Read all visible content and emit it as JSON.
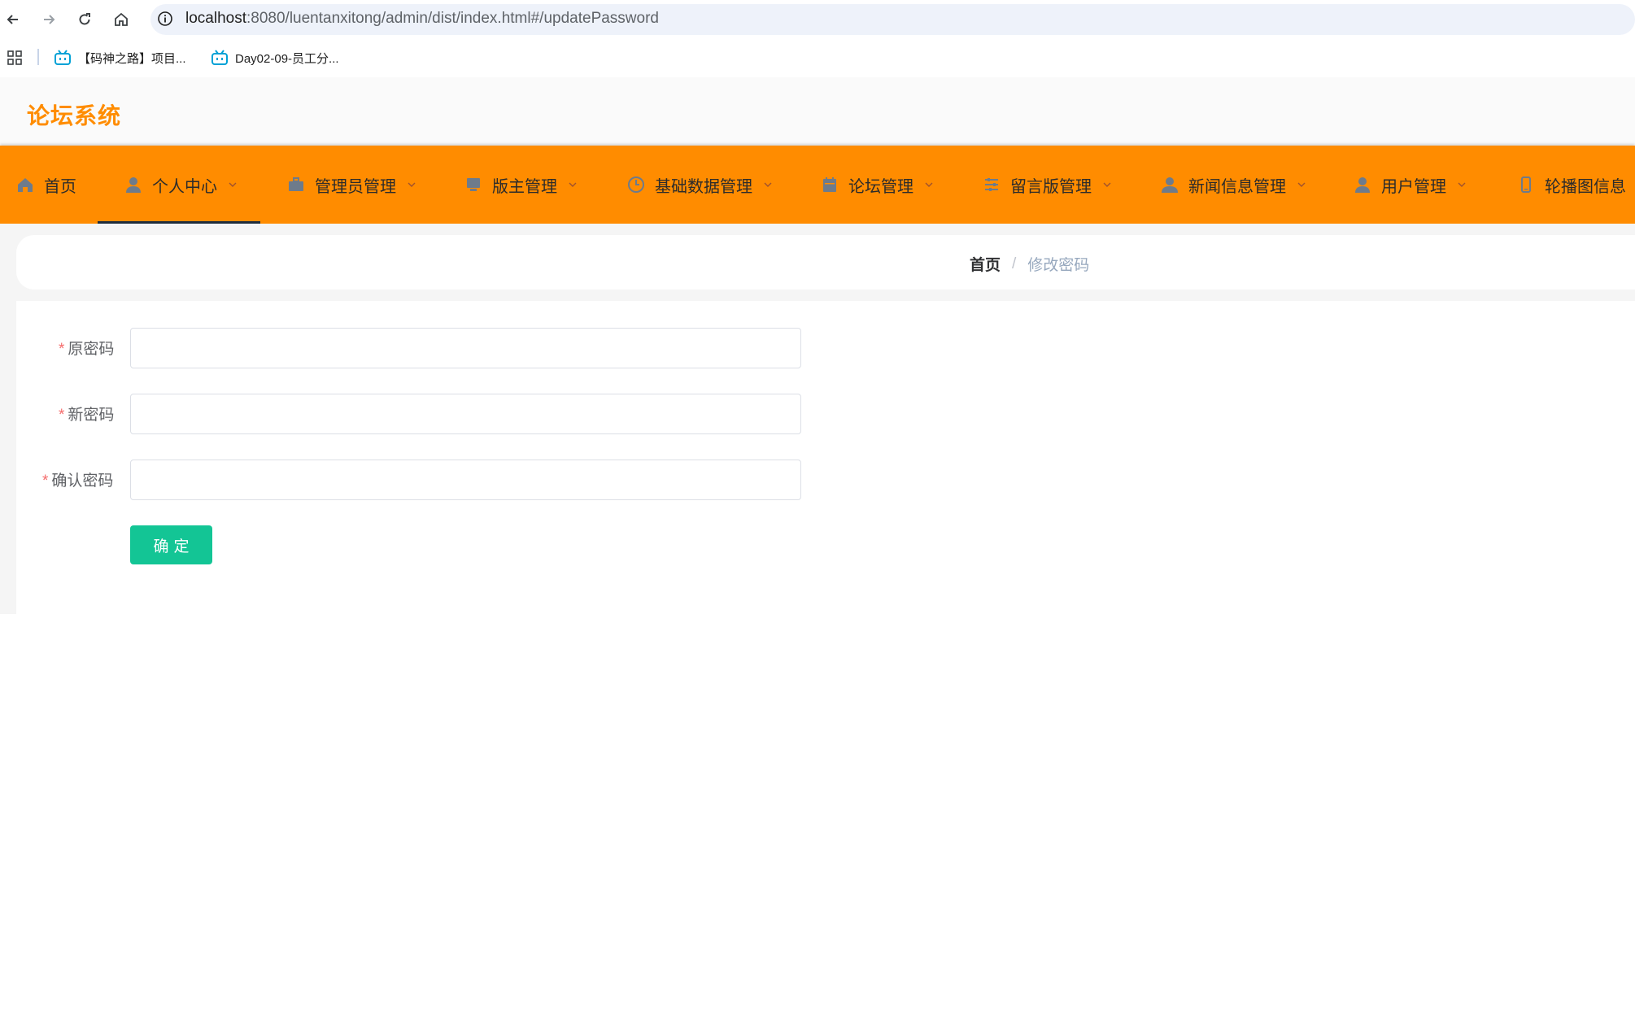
{
  "browser": {
    "url_host": "localhost",
    "url_path": ":8080/luentanxitong/admin/dist/index.html#/updatePassword",
    "bookmarks": [
      {
        "label": "【码神之路】项目..."
      },
      {
        "label": "Day02-09-员工分..."
      }
    ]
  },
  "app": {
    "title": "论坛系统"
  },
  "menu": {
    "items": [
      {
        "label": "首页",
        "icon": "home-icon"
      },
      {
        "label": "个人中心",
        "icon": "user-icon",
        "active": true
      },
      {
        "label": "管理员管理",
        "icon": "briefcase-icon"
      },
      {
        "label": "版主管理",
        "icon": "monitor-icon"
      },
      {
        "label": "基础数据管理",
        "icon": "clock-icon"
      },
      {
        "label": "论坛管理",
        "icon": "calendar-icon"
      },
      {
        "label": "留言版管理",
        "icon": "sliders-icon"
      },
      {
        "label": "新闻信息管理",
        "icon": "users-icon"
      },
      {
        "label": "用户管理",
        "icon": "user-icon"
      },
      {
        "label": "轮播图信息",
        "icon": "phone-icon"
      }
    ],
    "accent_color": "#ff8c00"
  },
  "breadcrumb": {
    "home": "首页",
    "separator": "/",
    "current": "修改密码"
  },
  "form": {
    "required_mark": "*",
    "old_password_label": "原密码",
    "new_password_label": "新密码",
    "confirm_password_label": "确认密码",
    "old_password_value": "",
    "new_password_value": "",
    "confirm_password_value": "",
    "submit_label": "确定",
    "submit_color": "#13c595"
  }
}
